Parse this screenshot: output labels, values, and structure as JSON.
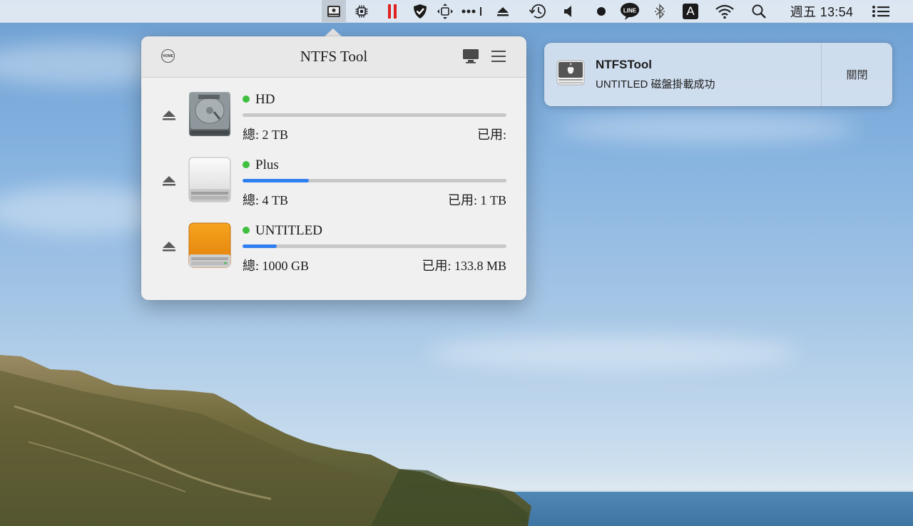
{
  "menubar": {
    "clock": "週五 13:54",
    "input_source": "A",
    "icons": [
      "ntfs-tool-icon",
      "cpu-icon",
      "pause-icon",
      "shield-check-icon",
      "move-arrows-icon",
      "dots-icon",
      "eject-icon",
      "time-machine-icon",
      "volume-icon",
      "record-dot-icon",
      "line-app-icon",
      "bluetooth-icon",
      "input-source-icon",
      "wifi-icon",
      "spotlight-search-icon",
      "notification-center-icon"
    ],
    "line_label": "LINE"
  },
  "popover": {
    "title": "NTFS Tool",
    "home_label": "HOME",
    "drives": [
      {
        "name": "HD",
        "total": "總: 2 TB",
        "used": "已用:",
        "usage": 0,
        "status": "mounted"
      },
      {
        "name": "Plus",
        "total": "總: 4 TB",
        "used": "已用: 1 TB",
        "usage": 0.25,
        "status": "mounted"
      },
      {
        "name": "UNTITLED",
        "total": "總: 1000 GB",
        "used": "已用: 133.8 MB",
        "usage": 0.13,
        "status": "mounted"
      }
    ]
  },
  "notification": {
    "app": "NTFSTool",
    "message": "UNTITLED 磁盤掛載成功",
    "close_label": "關閉"
  },
  "colors": {
    "accent": "#2f7ff0",
    "status_green": "#3fbf3f",
    "pause_red": "#e02020"
  }
}
